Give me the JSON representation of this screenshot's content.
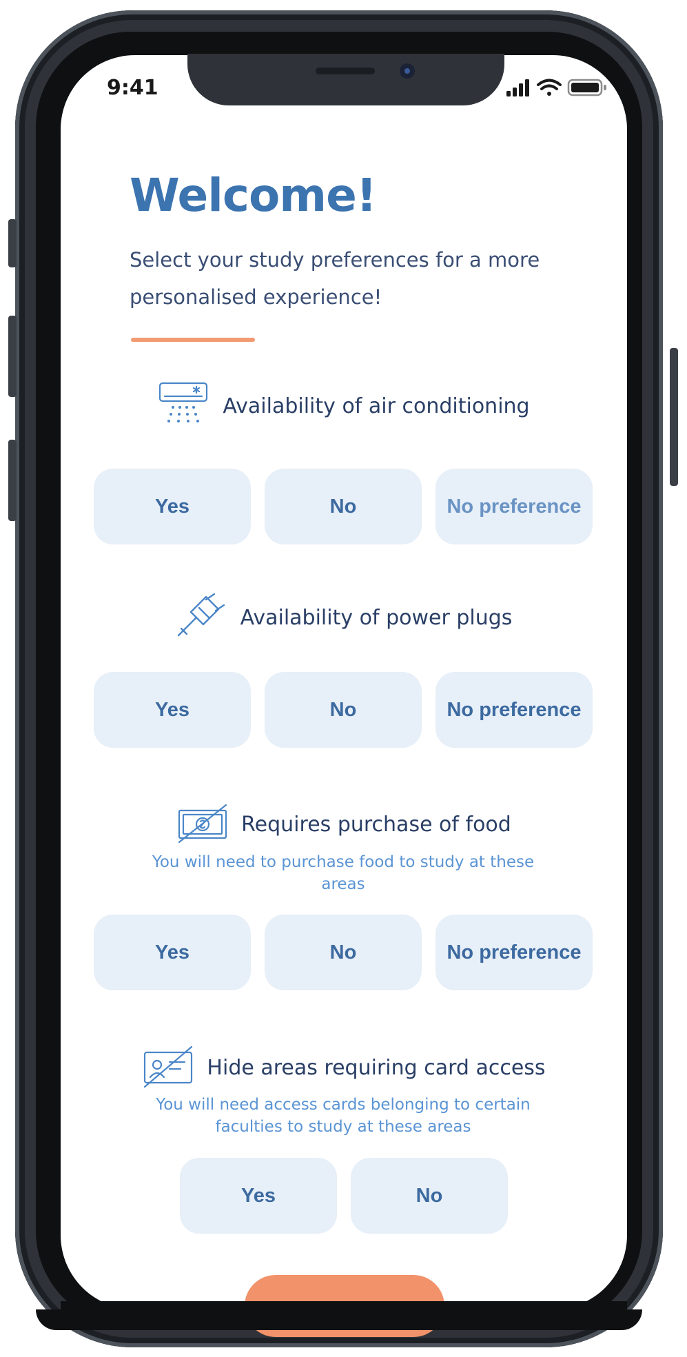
{
  "status_bar": {
    "time": "9:41"
  },
  "header": {
    "title": "Welcome!",
    "subtitle": "Select your study preferences for a more personalised experience!"
  },
  "sections": [
    {
      "label": "Availability of air conditioning",
      "icon": "air-conditioner-icon",
      "note": "",
      "options": [
        "Yes",
        "No",
        "No preference"
      ]
    },
    {
      "label": "Availability of power plugs",
      "icon": "power-plug-icon",
      "note": "",
      "options": [
        "Yes",
        "No",
        "No preference"
      ]
    },
    {
      "label": "Requires purchase of food",
      "icon": "cash-crossed-icon",
      "note": "You will need to purchase food to study at these areas",
      "options": [
        "Yes",
        "No",
        "No preference"
      ]
    },
    {
      "label": "Hide areas requiring card access",
      "icon": "access-card-crossed-icon",
      "note": "You will need access cards belonging to certain faculties to study at these areas",
      "options": [
        "Yes",
        "No"
      ]
    }
  ],
  "colors": {
    "accent": "#3c74b0",
    "button_bg": "#e7eff8",
    "divider": "#f29a72",
    "note_text": "#5a94d4"
  }
}
